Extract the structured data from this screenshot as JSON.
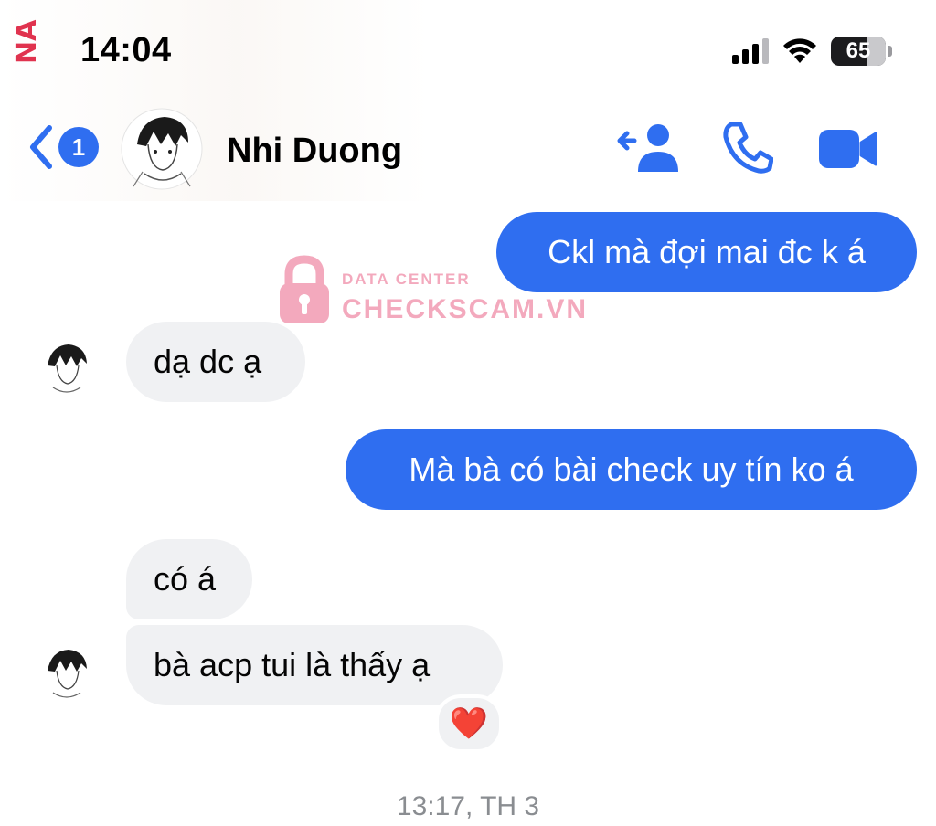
{
  "status_bar": {
    "edge_text": "NA",
    "time": "14:04",
    "battery_percent": "65",
    "battery_level": 0.65
  },
  "header": {
    "back_badge": "1",
    "contact_name": "Nhi Duong",
    "icons": [
      "back-chevron-icon",
      "add-person-icon",
      "phone-icon",
      "video-camera-icon"
    ]
  },
  "watermark": {
    "line1": "DATA CENTER",
    "line2": "CHECKSCAM.VN",
    "icon": "lock-icon"
  },
  "messages": [
    {
      "side": "outgoing",
      "text": "Ckl mà đợi mai đc k á"
    },
    {
      "side": "incoming",
      "text": "dạ dc ạ"
    },
    {
      "side": "outgoing",
      "text": "Mà bà có bài check uy tín ko á"
    },
    {
      "side": "incoming",
      "text": "có á"
    },
    {
      "side": "incoming",
      "text": "bà acp tui là thấy ạ",
      "reaction": "❤️"
    }
  ],
  "timestamp": "13:17, TH 3",
  "colors": {
    "accent": "#2f6ef0",
    "incoming_bubble": "#f0f1f3",
    "watermark": "#f3a9bd"
  }
}
